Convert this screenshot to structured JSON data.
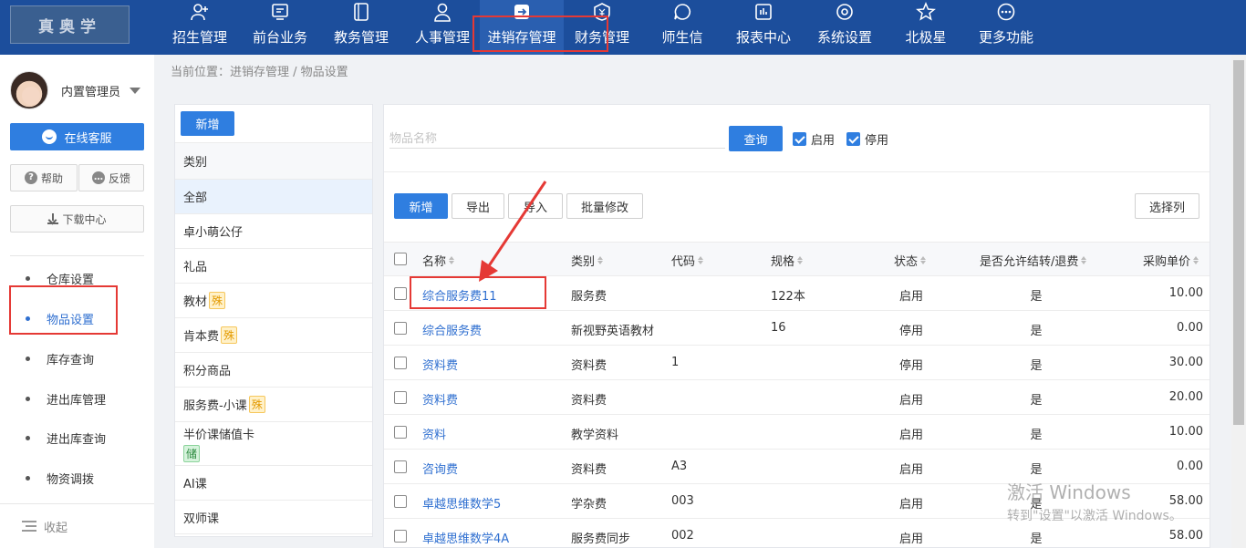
{
  "logo_text": "真奥学",
  "nav": [
    {
      "label": "招生管理",
      "icon": "user-plus-icon"
    },
    {
      "label": "前台业务",
      "icon": "monitor-icon"
    },
    {
      "label": "教务管理",
      "icon": "book-icon"
    },
    {
      "label": "人事管理",
      "icon": "person-icon"
    },
    {
      "label": "进销存管理",
      "icon": "arrow-box-icon"
    },
    {
      "label": "财务管理",
      "icon": "yen-shield-icon"
    },
    {
      "label": "师生信",
      "icon": "chat-icon"
    },
    {
      "label": "报表中心",
      "icon": "bar-report-icon"
    },
    {
      "label": "系统设置",
      "icon": "gear-icon"
    },
    {
      "label": "北极星",
      "icon": "star-icon"
    },
    {
      "label": "更多功能",
      "icon": "more-icon"
    }
  ],
  "user": {
    "name": "内置管理员"
  },
  "sidebar": {
    "online_service": "在线客服",
    "help": "帮助",
    "feedback": "反馈",
    "download_center": "下载中心",
    "items": [
      {
        "label": "仓库设置"
      },
      {
        "label": "物品设置"
      },
      {
        "label": "库存查询"
      },
      {
        "label": "进出库管理"
      },
      {
        "label": "进出库查询"
      },
      {
        "label": "物资调拨"
      }
    ],
    "collapse": "收起"
  },
  "breadcrumb": "当前位置：进销存管理 / 物品设置",
  "categories": {
    "add_label": "新增",
    "header": "类别",
    "items": [
      {
        "label": "全部",
        "tag": ""
      },
      {
        "label": "卓小萌公仔",
        "tag": ""
      },
      {
        "label": "礼品",
        "tag": ""
      },
      {
        "label": "教材",
        "tag": "殊"
      },
      {
        "label": "肯本费",
        "tag": "殊"
      },
      {
        "label": "积分商品",
        "tag": ""
      },
      {
        "label": "服务费-小课",
        "tag": "殊"
      },
      {
        "label": "半价课储值卡",
        "tag": "储"
      },
      {
        "label": "AI课",
        "tag": ""
      },
      {
        "label": "双师课",
        "tag": ""
      }
    ]
  },
  "search": {
    "placeholder": "物品名称",
    "query_label": "查询",
    "enabled_label": "启用",
    "disabled_label": "停用"
  },
  "toolbar": {
    "add": "新增",
    "export": "导出",
    "import": "导入",
    "batch_edit": "批量修改",
    "select_columns": "选择列"
  },
  "table": {
    "headers": [
      "名称",
      "类别",
      "代码",
      "规格",
      "状态",
      "是否允许结转/退费",
      "采购单价"
    ],
    "rows": [
      {
        "name": "综合服务费11",
        "category": "服务费",
        "code": "",
        "spec": "122本",
        "status": "启用",
        "refund": "是",
        "price": "10.00"
      },
      {
        "name": "综合服务费",
        "category": "新视野英语教材",
        "code": "",
        "spec": "16",
        "status": "停用",
        "refund": "是",
        "price": "0.00"
      },
      {
        "name": "资料费",
        "category": "资料费",
        "code": "1",
        "spec": "",
        "status": "停用",
        "refund": "是",
        "price": "30.00"
      },
      {
        "name": "资料费",
        "category": "资料费",
        "code": "",
        "spec": "",
        "status": "启用",
        "refund": "是",
        "price": "20.00"
      },
      {
        "name": "资料",
        "category": "教学资料",
        "code": "",
        "spec": "",
        "status": "启用",
        "refund": "是",
        "price": "10.00"
      },
      {
        "name": "咨询费",
        "category": "资料费",
        "code": "A3",
        "spec": "",
        "status": "启用",
        "refund": "是",
        "price": "0.00"
      },
      {
        "name": "卓越思维数学5",
        "category": "学杂费",
        "code": "003",
        "spec": "",
        "status": "启用",
        "refund": "是",
        "price": "58.00"
      },
      {
        "name": "卓越思维数学4A",
        "category": "服务费同步",
        "code": "002",
        "spec": "",
        "status": "启用",
        "refund": "是",
        "price": "58.00"
      }
    ]
  },
  "watermark": {
    "line1": "激活 Windows",
    "line2": "转到\"设置\"以激活 Windows。"
  },
  "colors": {
    "nav_bg": "#1c4e9c",
    "primary": "#2f7ee0",
    "link": "#2f6fd0",
    "highlight": "#e53935"
  }
}
